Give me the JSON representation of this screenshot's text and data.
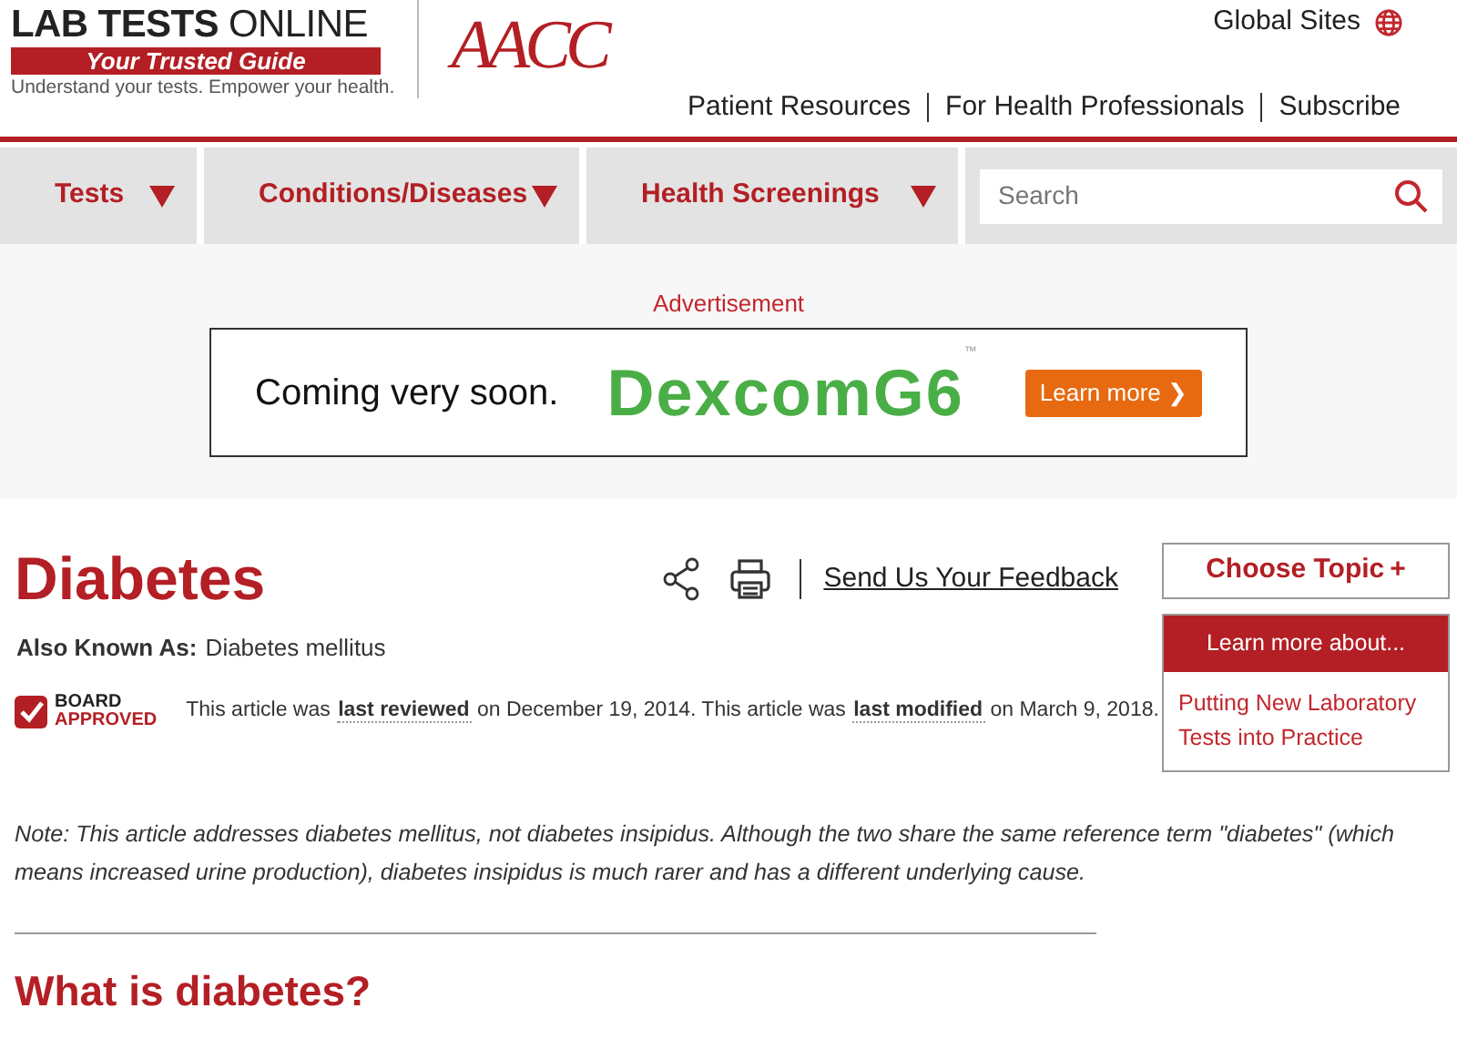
{
  "logo": {
    "title": "**LAB TESTS** ONLINE",
    "tagline": "Your Trusted Guide",
    "subtitle": "Understand your tests. Empower your health.",
    "partner": "AACC"
  },
  "global_sites": "Global Sites",
  "top_links": [
    "Patient Resources",
    "For Health Professionals",
    "Subscribe"
  ],
  "nav": [
    {
      "label": "Tests",
      "expanded": false
    },
    {
      "label": "Conditions/Diseases",
      "expanded": false
    },
    {
      "label": "Health Screenings",
      "expanded": false
    }
  ],
  "search": {
    "placeholder": "Search"
  },
  "ad": {
    "label": "Advertisement",
    "text": "Coming very soon.",
    "brand": "DexcomG6",
    "trademark": "™",
    "button": "Learn more ❯"
  },
  "article": {
    "title": "Diabetes",
    "feedback": "Send Us Your Feedback",
    "aka_label": "Also Known As:",
    "aka": "Diabetes mellitus",
    "badge": [
      "BOARD",
      "APPROVED"
    ],
    "review": [
      "This article was ",
      "last reviewed",
      " on December 19, 2014. This article was ",
      "last modified",
      " on March 9, 2018."
    ],
    "note": [
      "Note: This article addresses diabetes mellitus, not ",
      "diabetes insipidus",
      ". Although the two share the same reference term \"diabetes\" (which means increased urine production), diabetes insipidus is much rarer and has a different underlying cause."
    ],
    "heading": "What is diabetes?"
  },
  "sidebar": {
    "choose": "Choose Topic",
    "plus": "+",
    "learn_title": "Learn more about...",
    "links": [
      "Putting New Laboratory Tests into Practice"
    ]
  }
}
